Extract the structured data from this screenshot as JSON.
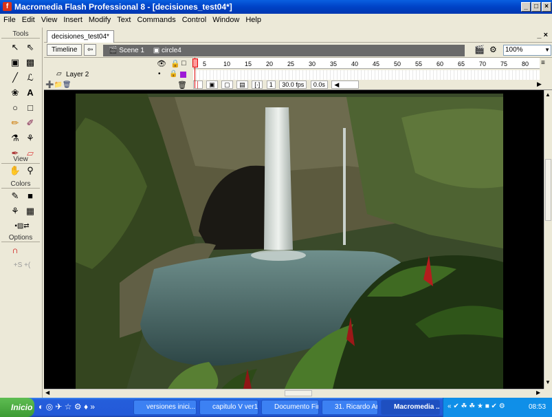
{
  "window": {
    "title": "Macromedia Flash Professional 8 - [decisiones_test04*]",
    "controls": [
      "_",
      "□",
      "×"
    ]
  },
  "menu": [
    "File",
    "Edit",
    "View",
    "Insert",
    "Modify",
    "Text",
    "Commands",
    "Control",
    "Window",
    "Help"
  ],
  "tools": {
    "header": "Tools",
    "view_label": "View",
    "colors_label": "Colors",
    "options_label": "Options"
  },
  "document": {
    "tab": "decisiones_test04*",
    "doc_controls": "_ ×",
    "timeline_button": "Timeline",
    "scene": "Scene 1",
    "symbol": "circle4",
    "zoom": "100%"
  },
  "timeline": {
    "ruler": [
      "5",
      "10",
      "15",
      "20",
      "25",
      "30",
      "35",
      "40",
      "45",
      "50",
      "55",
      "60",
      "65",
      "70",
      "75",
      "80"
    ],
    "layer": "Layer 2",
    "current_frame": "1",
    "fps": "30.0 fps",
    "time": "0.0s"
  },
  "taskbar": {
    "start": "Inicio",
    "items": [
      {
        "label": "versiones inici...",
        "active": false
      },
      {
        "label": "capitulo V ver1...",
        "active": false
      },
      {
        "label": "Documento Fin...",
        "active": false
      },
      {
        "label": "31. Ricardo Ar...",
        "active": false
      },
      {
        "label": "Macromedia ...",
        "active": true
      }
    ],
    "clock": "08:53"
  }
}
